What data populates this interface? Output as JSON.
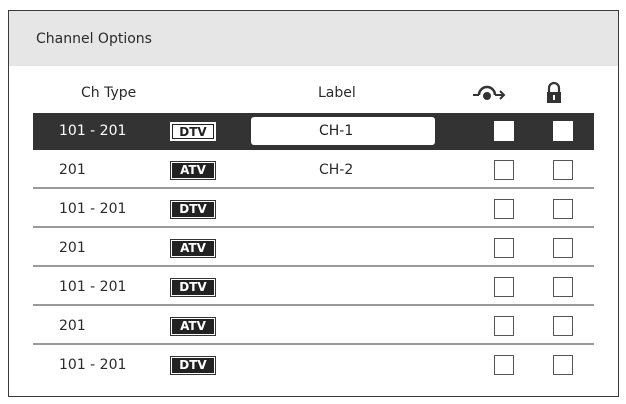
{
  "panel": {
    "title": "Channel Options"
  },
  "columns": {
    "ch_type": "Ch Type",
    "label": "Label",
    "skip_icon": "skip-channel-icon",
    "lock_icon": "lock-icon"
  },
  "rows": [
    {
      "ch": "101 - 201",
      "type": "DTV",
      "label": "CH-1",
      "skip": false,
      "lock": false,
      "selected": true
    },
    {
      "ch": "201",
      "type": "ATV",
      "label": "CH-2",
      "skip": false,
      "lock": false,
      "selected": false
    },
    {
      "ch": "101 - 201",
      "type": "DTV",
      "label": "",
      "skip": false,
      "lock": false,
      "selected": false
    },
    {
      "ch": "201",
      "type": "ATV",
      "label": "",
      "skip": false,
      "lock": false,
      "selected": false
    },
    {
      "ch": "101 - 201",
      "type": "DTV",
      "label": "",
      "skip": false,
      "lock": false,
      "selected": false
    },
    {
      "ch": "201",
      "type": "ATV",
      "label": "",
      "skip": false,
      "lock": false,
      "selected": false
    },
    {
      "ch": "101 - 201",
      "type": "DTV",
      "label": "",
      "skip": false,
      "lock": false,
      "selected": false
    }
  ]
}
